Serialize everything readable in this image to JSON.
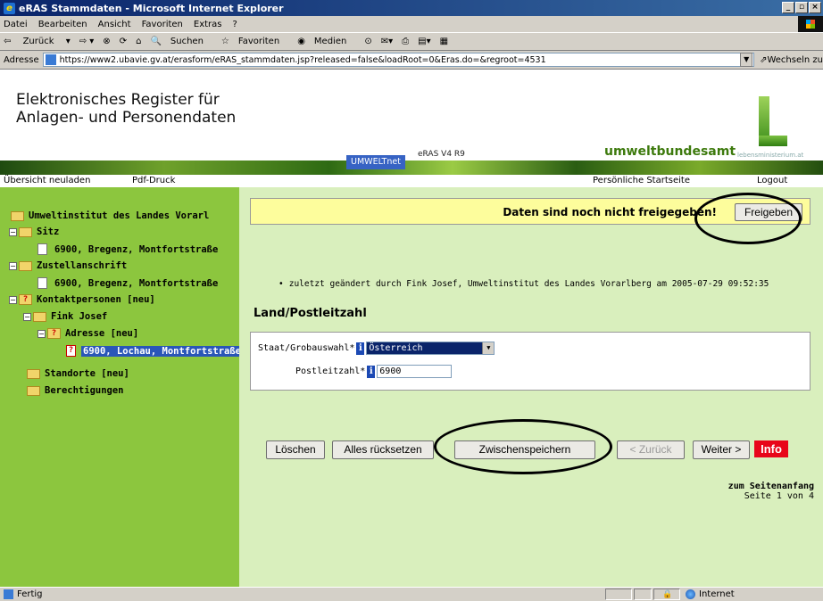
{
  "window": {
    "title": "eRAS Stammdaten - Microsoft Internet Explorer"
  },
  "menu": [
    "Datei",
    "Bearbeiten",
    "Ansicht",
    "Favoriten",
    "Extras",
    "?"
  ],
  "toolbar": {
    "back": "Zurück",
    "search": "Suchen",
    "favorites": "Favoriten",
    "media": "Medien"
  },
  "address": {
    "label": "Adresse",
    "url": "https://www2.ubavie.gv.at/erasform/eRAS_stammdaten.jsp?released=false&loadRoot=0&Eras.do=&regroot=4531",
    "go": "Wechseln zu"
  },
  "header": {
    "app_title": "Elektronisches Register für Anlagen- und Personendaten",
    "version": "eRAS V4 R9",
    "brand": "umweltbundesamt",
    "brand_sub": "lebensministerium.at",
    "umweltnet": "UMWELTnet"
  },
  "links": {
    "reload": "Übersicht neuladen",
    "pdf": "Pdf-Druck",
    "home": "Persönliche Startseite",
    "logout": "Logout"
  },
  "tree": [
    {
      "label": "Umweltinstitut des Landes Vorarl"
    },
    {
      "label": "Sitz"
    },
    {
      "label": "6900, Bregenz, Montfortstraße"
    },
    {
      "label": "Zustellanschrift"
    },
    {
      "label": "6900, Bregenz, Montfortstraße"
    },
    {
      "label": "Kontaktpersonen  [neu]"
    },
    {
      "label": "Fink Josef"
    },
    {
      "label": "Adresse  [neu]"
    },
    {
      "label": "6900, Lochau, Montfortstraße"
    },
    {
      "label": "Standorte  [neu]"
    },
    {
      "label": "Berechtigungen"
    }
  ],
  "notice": {
    "message": "Daten sind noch nicht freigegeben!",
    "button": "Freigeben"
  },
  "changed_info": "zuletzt geändert durch Fink Josef, Umweltinstitut des Landes Vorarlberg am 2005-07-29 09:52:35",
  "section_title": "Land/Postleitzahl",
  "form": {
    "country_label": "Staat/Grobauswahl*",
    "country_value": "Österreich",
    "zip_label": "Postleitzahl*",
    "zip_value": "6900"
  },
  "buttons": {
    "delete": "Löschen",
    "reset": "Alles rücksetzen",
    "save": "Zwischenspeichern",
    "back": "< Zurück",
    "next": "Weiter >",
    "info": "Info"
  },
  "page_nav": {
    "top": "zum Seitenanfang",
    "page": "Seite 1 von 4"
  },
  "status": {
    "text": "Fertig",
    "zone": "Internet"
  },
  "colors": {
    "sidebar": "#8cc63e",
    "main": "#d9efbd",
    "notice": "#fdfd9c",
    "info": "#e8061a"
  }
}
